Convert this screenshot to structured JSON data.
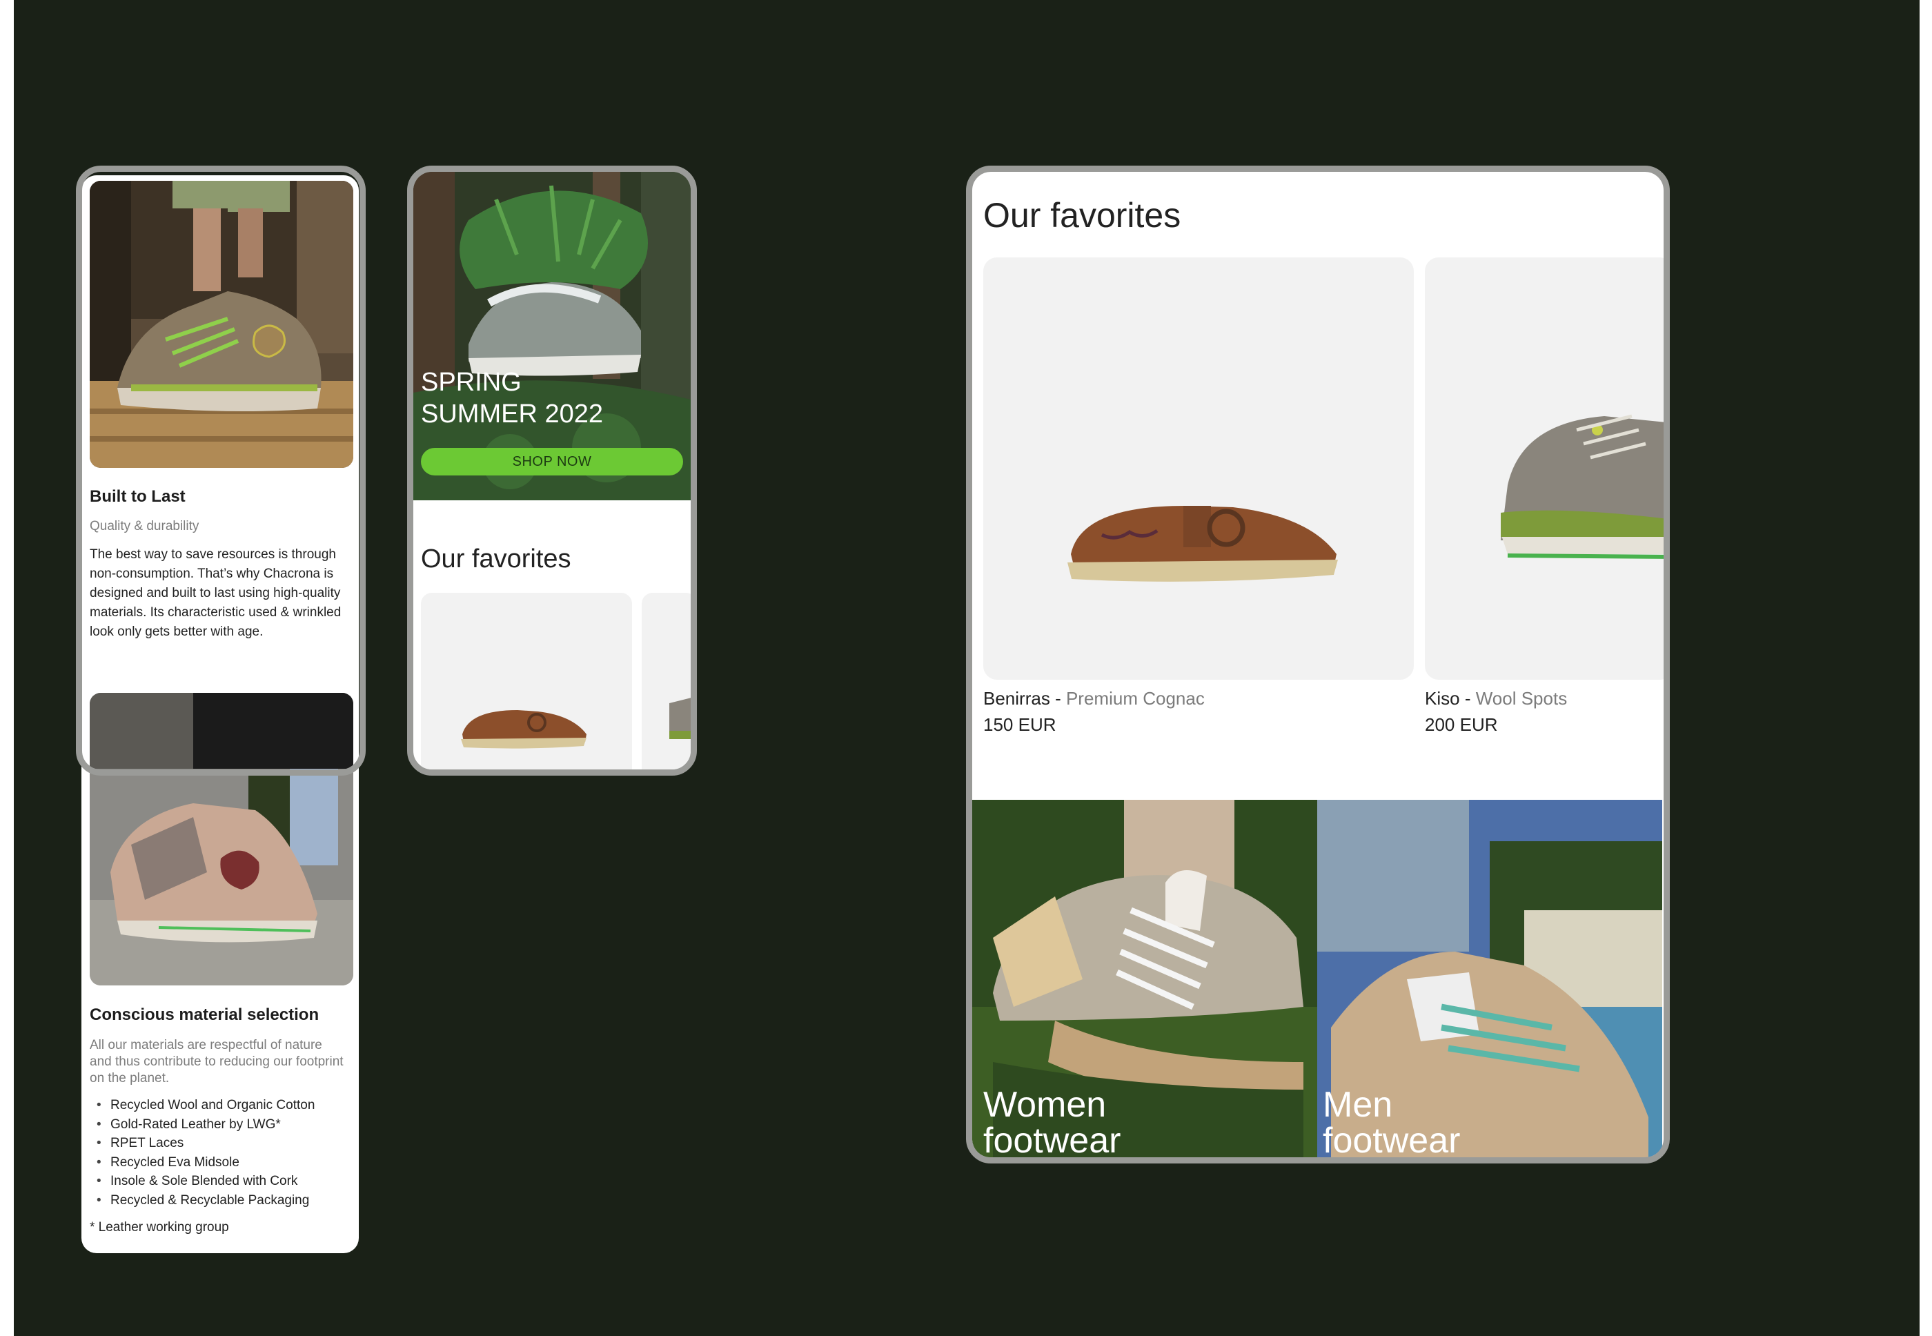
{
  "article": {
    "title": "Built to Last",
    "subtitle": "Quality & durability",
    "body": "The best way to save resources is through non-consumption. That’s why Chacrona is designed and built to last using high-quality materials. Its characteristic used & wrinkled look only gets better with age.",
    "materials_title": "Conscious material selection",
    "materials_intro": "All our materials are respectful of nature and thus contribute to reducing our footprint on the planet.",
    "materials": [
      "Recycled Wool and Organic Cotton",
      "Gold-Rated Leather by LWG*",
      "RPET Laces",
      "Recycled Eva Midsole",
      "Insole & Sole Blended with Cork",
      "Recycled & Recyclable Packaging"
    ],
    "footnote": "* Leather working group"
  },
  "hero": {
    "title_line1": "SPRING",
    "title_line2": "SUMMER 2022",
    "cta": "SHOP NOW",
    "favorites_title": "Our favorites"
  },
  "favorites": {
    "title": "Our favorites",
    "separator": "-",
    "products": [
      {
        "name": "Benirras",
        "variant": "Premium Cognac",
        "price": "150 EUR"
      },
      {
        "name": "Kiso",
        "variant": "Wool Spots",
        "price": "200 EUR"
      }
    ],
    "categories": [
      {
        "line1": "Women",
        "line2": "footwear"
      },
      {
        "line1": "Men",
        "line2": "footwear"
      }
    ]
  },
  "colors": {
    "background": "#1a2117",
    "frame": "#9a9b98",
    "cta": "#6cc934",
    "card": "#f2f2f2"
  },
  "icons": [
    "sneaker-photo",
    "brown-shoe-image",
    "wool-boot-image"
  ]
}
